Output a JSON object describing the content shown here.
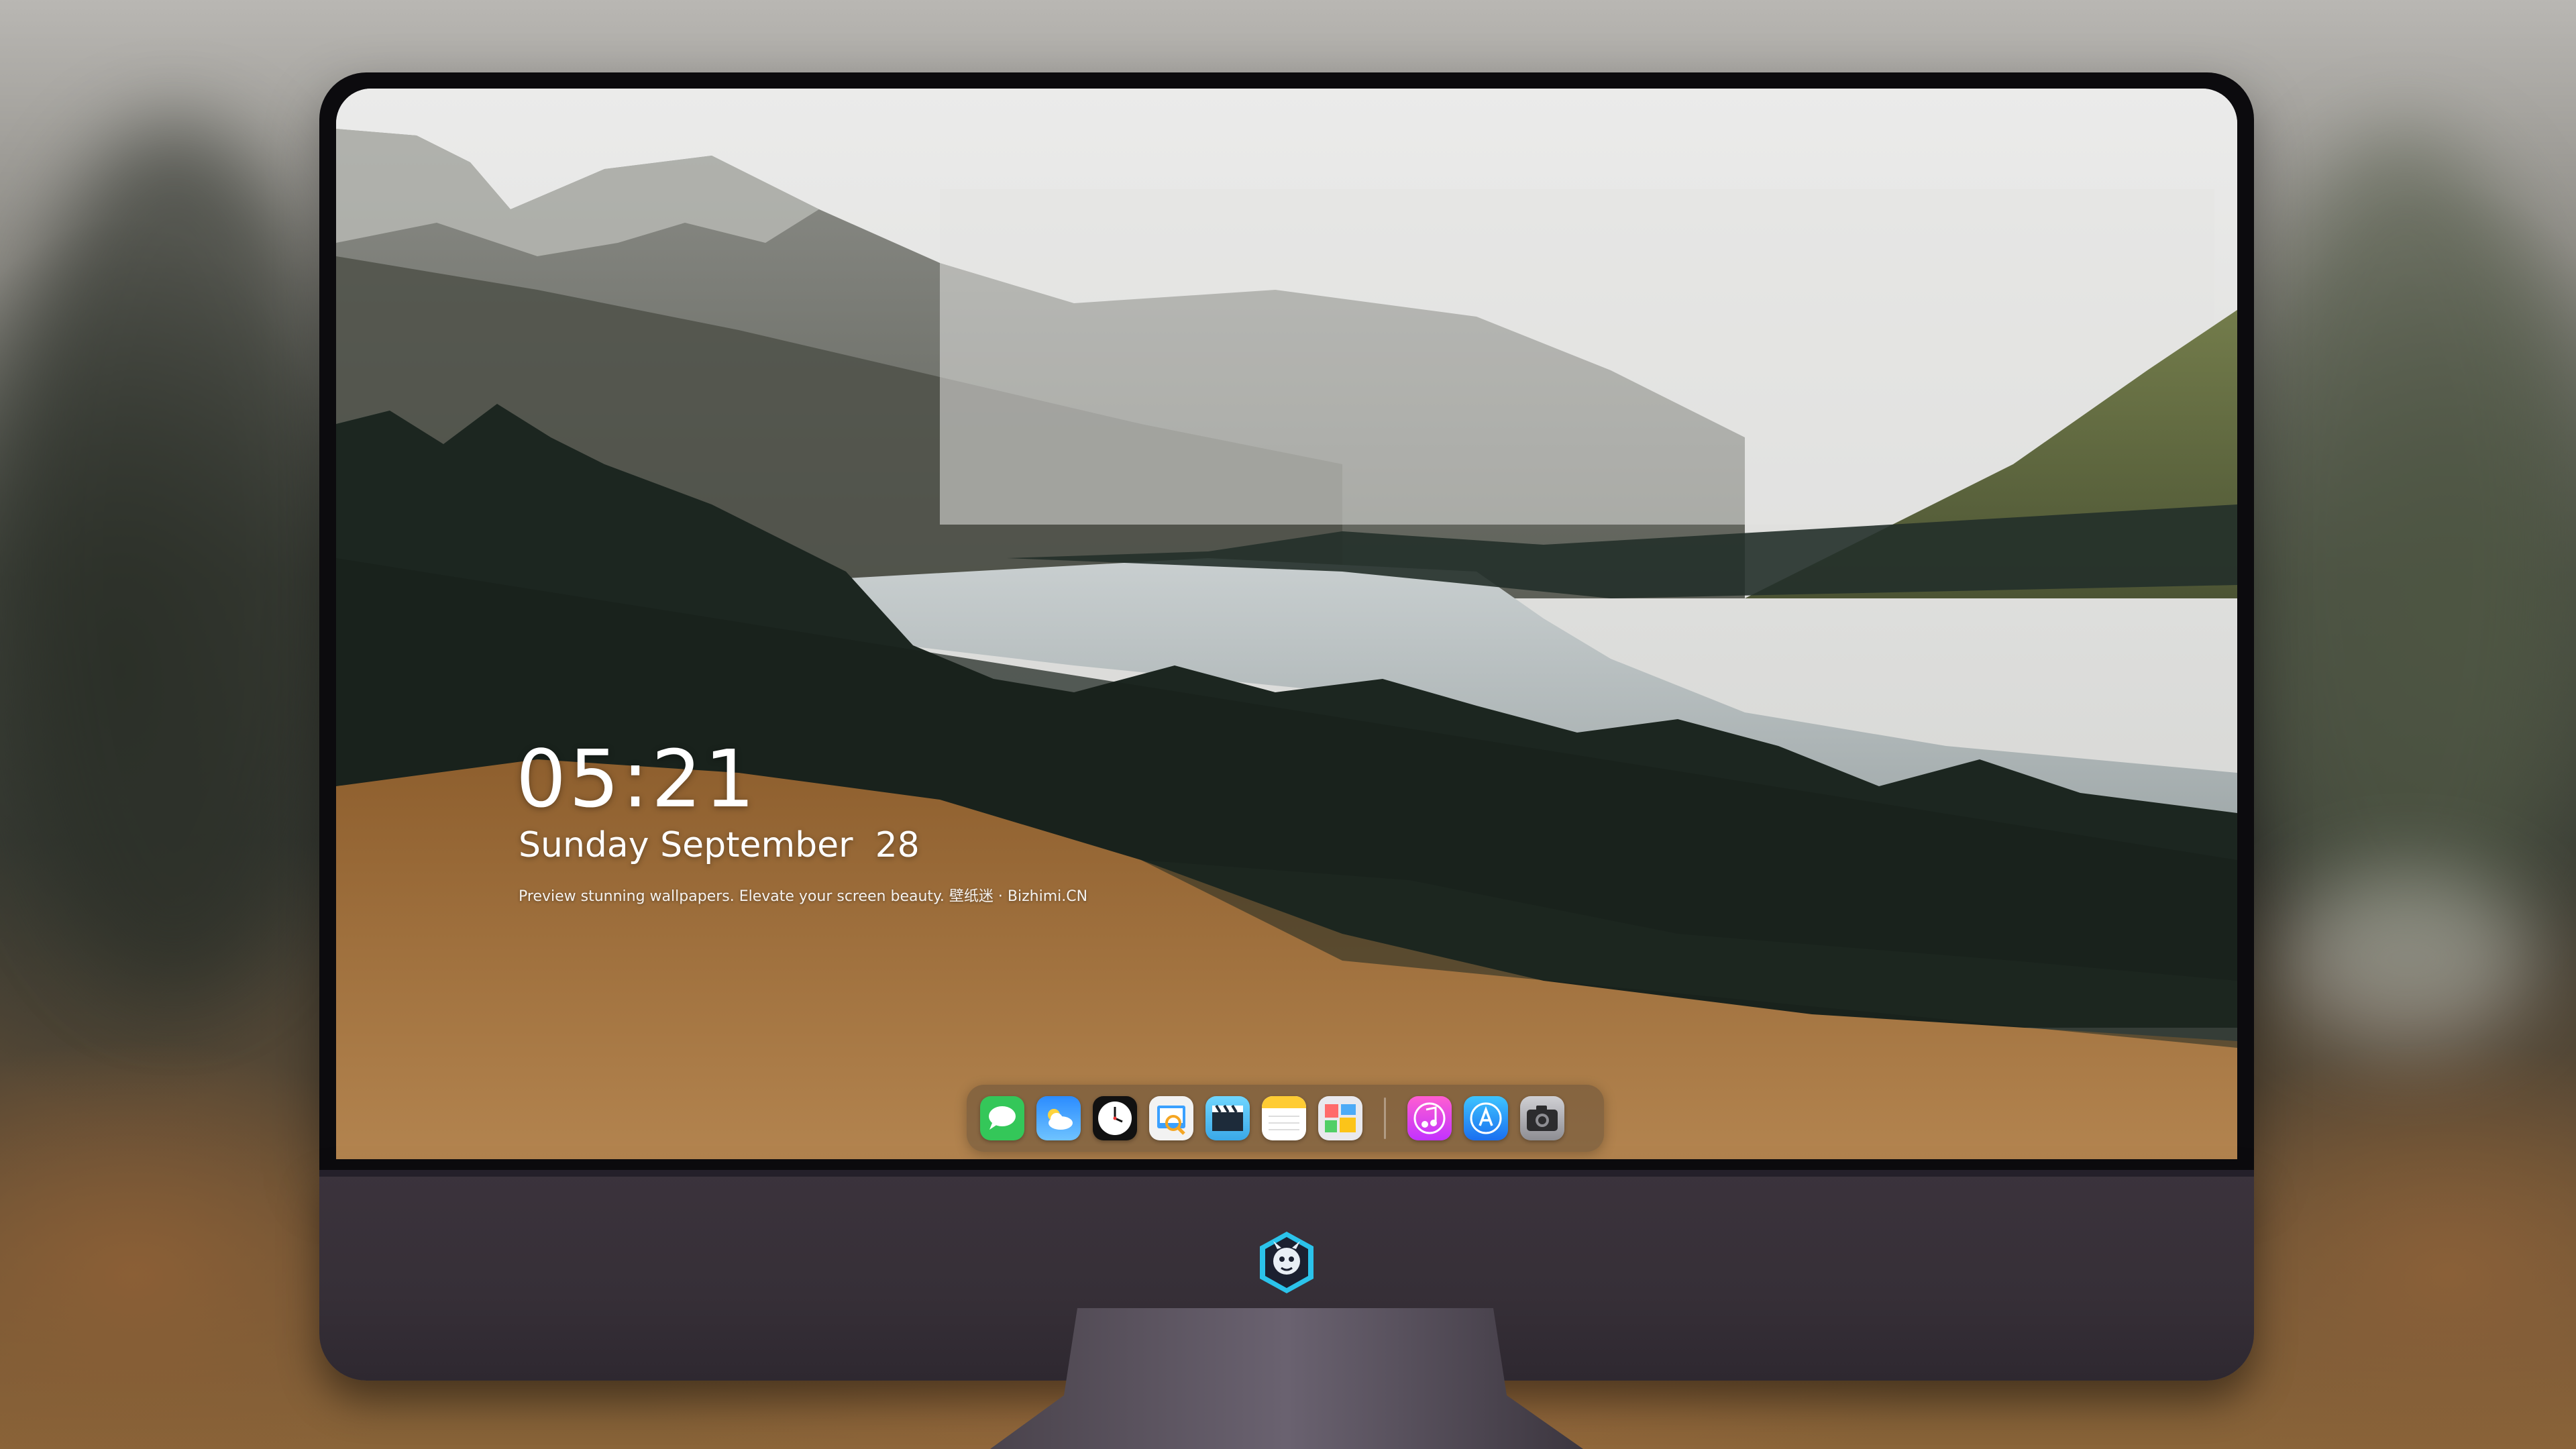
{
  "lockscreen": {
    "time": "05:21",
    "date": "Sunday September  28",
    "tagline": "Preview stunning wallpapers. Elevate your screen beauty. 壁纸迷 · Bizhimi.CN"
  },
  "dock": {
    "apps": [
      {
        "name": "messages-icon"
      },
      {
        "name": "weather-icon"
      },
      {
        "name": "clock-icon"
      },
      {
        "name": "preview-icon"
      },
      {
        "name": "video-editor-icon"
      },
      {
        "name": "notes-icon"
      },
      {
        "name": "photo-board-icon"
      },
      {
        "name": "music-icon"
      },
      {
        "name": "app-store-icon"
      },
      {
        "name": "camera-icon"
      }
    ]
  },
  "colors": {
    "bezel": "#0c0b0e",
    "chin": "#362f37",
    "messages": "#34c759",
    "weather": "#1e90ff",
    "music": "#e040fb",
    "app_store": "#1a8cff"
  }
}
